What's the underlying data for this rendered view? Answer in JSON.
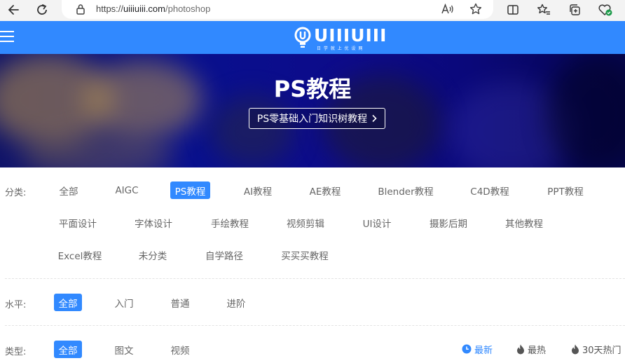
{
  "browser": {
    "url_scheme": "https://",
    "url_host": "uiiiuiii.com",
    "url_path": "/photoshop"
  },
  "header": {
    "logo_text": "UIIIUIII",
    "logo_subtitle": "日 学 就 上 优 设 网",
    "accent_color": "#3189ff"
  },
  "banner": {
    "title": "PS教程",
    "button_label": "PS零基础入门知识树教程"
  },
  "filters": {
    "category": {
      "label": "分类:",
      "items": [
        "全部",
        "AIGC",
        "PS教程",
        "AI教程",
        "AE教程",
        "Blender教程",
        "C4D教程",
        "PPT教程",
        "平面设计",
        "字体设计",
        "手绘教程",
        "视频剪辑",
        "UI设计",
        "摄影后期",
        "其他教程",
        "Excel教程",
        "未分类",
        "自学路径",
        "买买买教程"
      ],
      "active": "PS教程"
    },
    "level": {
      "label": "水平:",
      "items": [
        "全部",
        "入门",
        "普通",
        "进阶"
      ],
      "active": "全部"
    },
    "type": {
      "label": "类型:",
      "items": [
        "全部",
        "图文",
        "视频"
      ],
      "active": "全部"
    },
    "sort": {
      "items": [
        "最新",
        "最热",
        "30天热门"
      ],
      "active": "最新"
    }
  }
}
